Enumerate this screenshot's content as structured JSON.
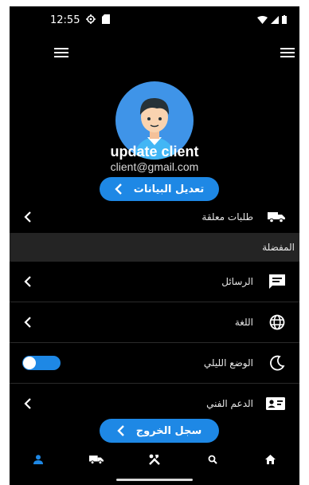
{
  "status_bar": {
    "time": "12:55"
  },
  "profile": {
    "name": "update client",
    "email": "client@gmail.com",
    "edit_button_label": "تعديل البيانات"
  },
  "menu": {
    "pending_orders": "طلبات معلقة",
    "section_favorites": "المفضلة",
    "messages": "الرسائل",
    "language": "اللغة",
    "dark_mode": "الوضع الليلي",
    "dark_mode_enabled": true,
    "support": "الدعم الفني"
  },
  "logout_button_label": "سجل الخروج",
  "bottom_nav": [
    {
      "icon": "person-icon",
      "active": true
    },
    {
      "icon": "truck-icon",
      "active": false
    },
    {
      "icon": "tools-icon",
      "active": false
    },
    {
      "icon": "search-icon",
      "active": false
    },
    {
      "icon": "home-icon",
      "active": false
    }
  ],
  "colors": {
    "background": "#000000",
    "accent": "#1e88e5",
    "section": "#242424"
  }
}
